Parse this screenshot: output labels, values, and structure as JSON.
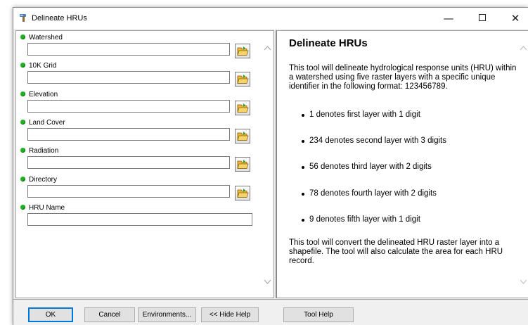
{
  "window": {
    "title": "Delineate HRUs",
    "controls": {
      "minimize": "—",
      "close": "✕"
    }
  },
  "icons": {
    "app": "hammer-tool-icon",
    "browse": "folder-open-icon",
    "required": "green-dot-icon"
  },
  "params": [
    {
      "label": "Watershed",
      "value": ""
    },
    {
      "label": "10K Grid",
      "value": ""
    },
    {
      "label": "Elevation",
      "value": ""
    },
    {
      "label": "Land Cover",
      "value": ""
    },
    {
      "label": "Radiation",
      "value": ""
    },
    {
      "label": "Directory",
      "value": ""
    },
    {
      "label": "HRU Name",
      "value": ""
    }
  ],
  "help": {
    "title": "Delineate HRUs",
    "intro": "This tool will delineate hydrological response units (HRU) within a watershed using five raster layers with a specific unique identifier in the following format: 123456789.",
    "bullets": [
      "1 denotes first layer with 1 digit",
      "234 denotes second layer with 3 digits",
      "56 denotes third layer with 2 digits",
      "78 denotes fourth layer with 2 digits",
      "9 denotes fifth layer with 1 digit"
    ],
    "outro": "This tool will convert the delineated HRU raster layer into a shapefile. The tool will also calculate the area for each HRU record."
  },
  "buttons": {
    "ok": "OK",
    "cancel": "Cancel",
    "environments": "Environments...",
    "hide_help": "<< Hide Help",
    "tool_help": "Tool Help"
  },
  "colors": {
    "required_dot": "#1fb41f",
    "default_button_border": "#0078d7",
    "panel_background": "#f0f0f0"
  }
}
